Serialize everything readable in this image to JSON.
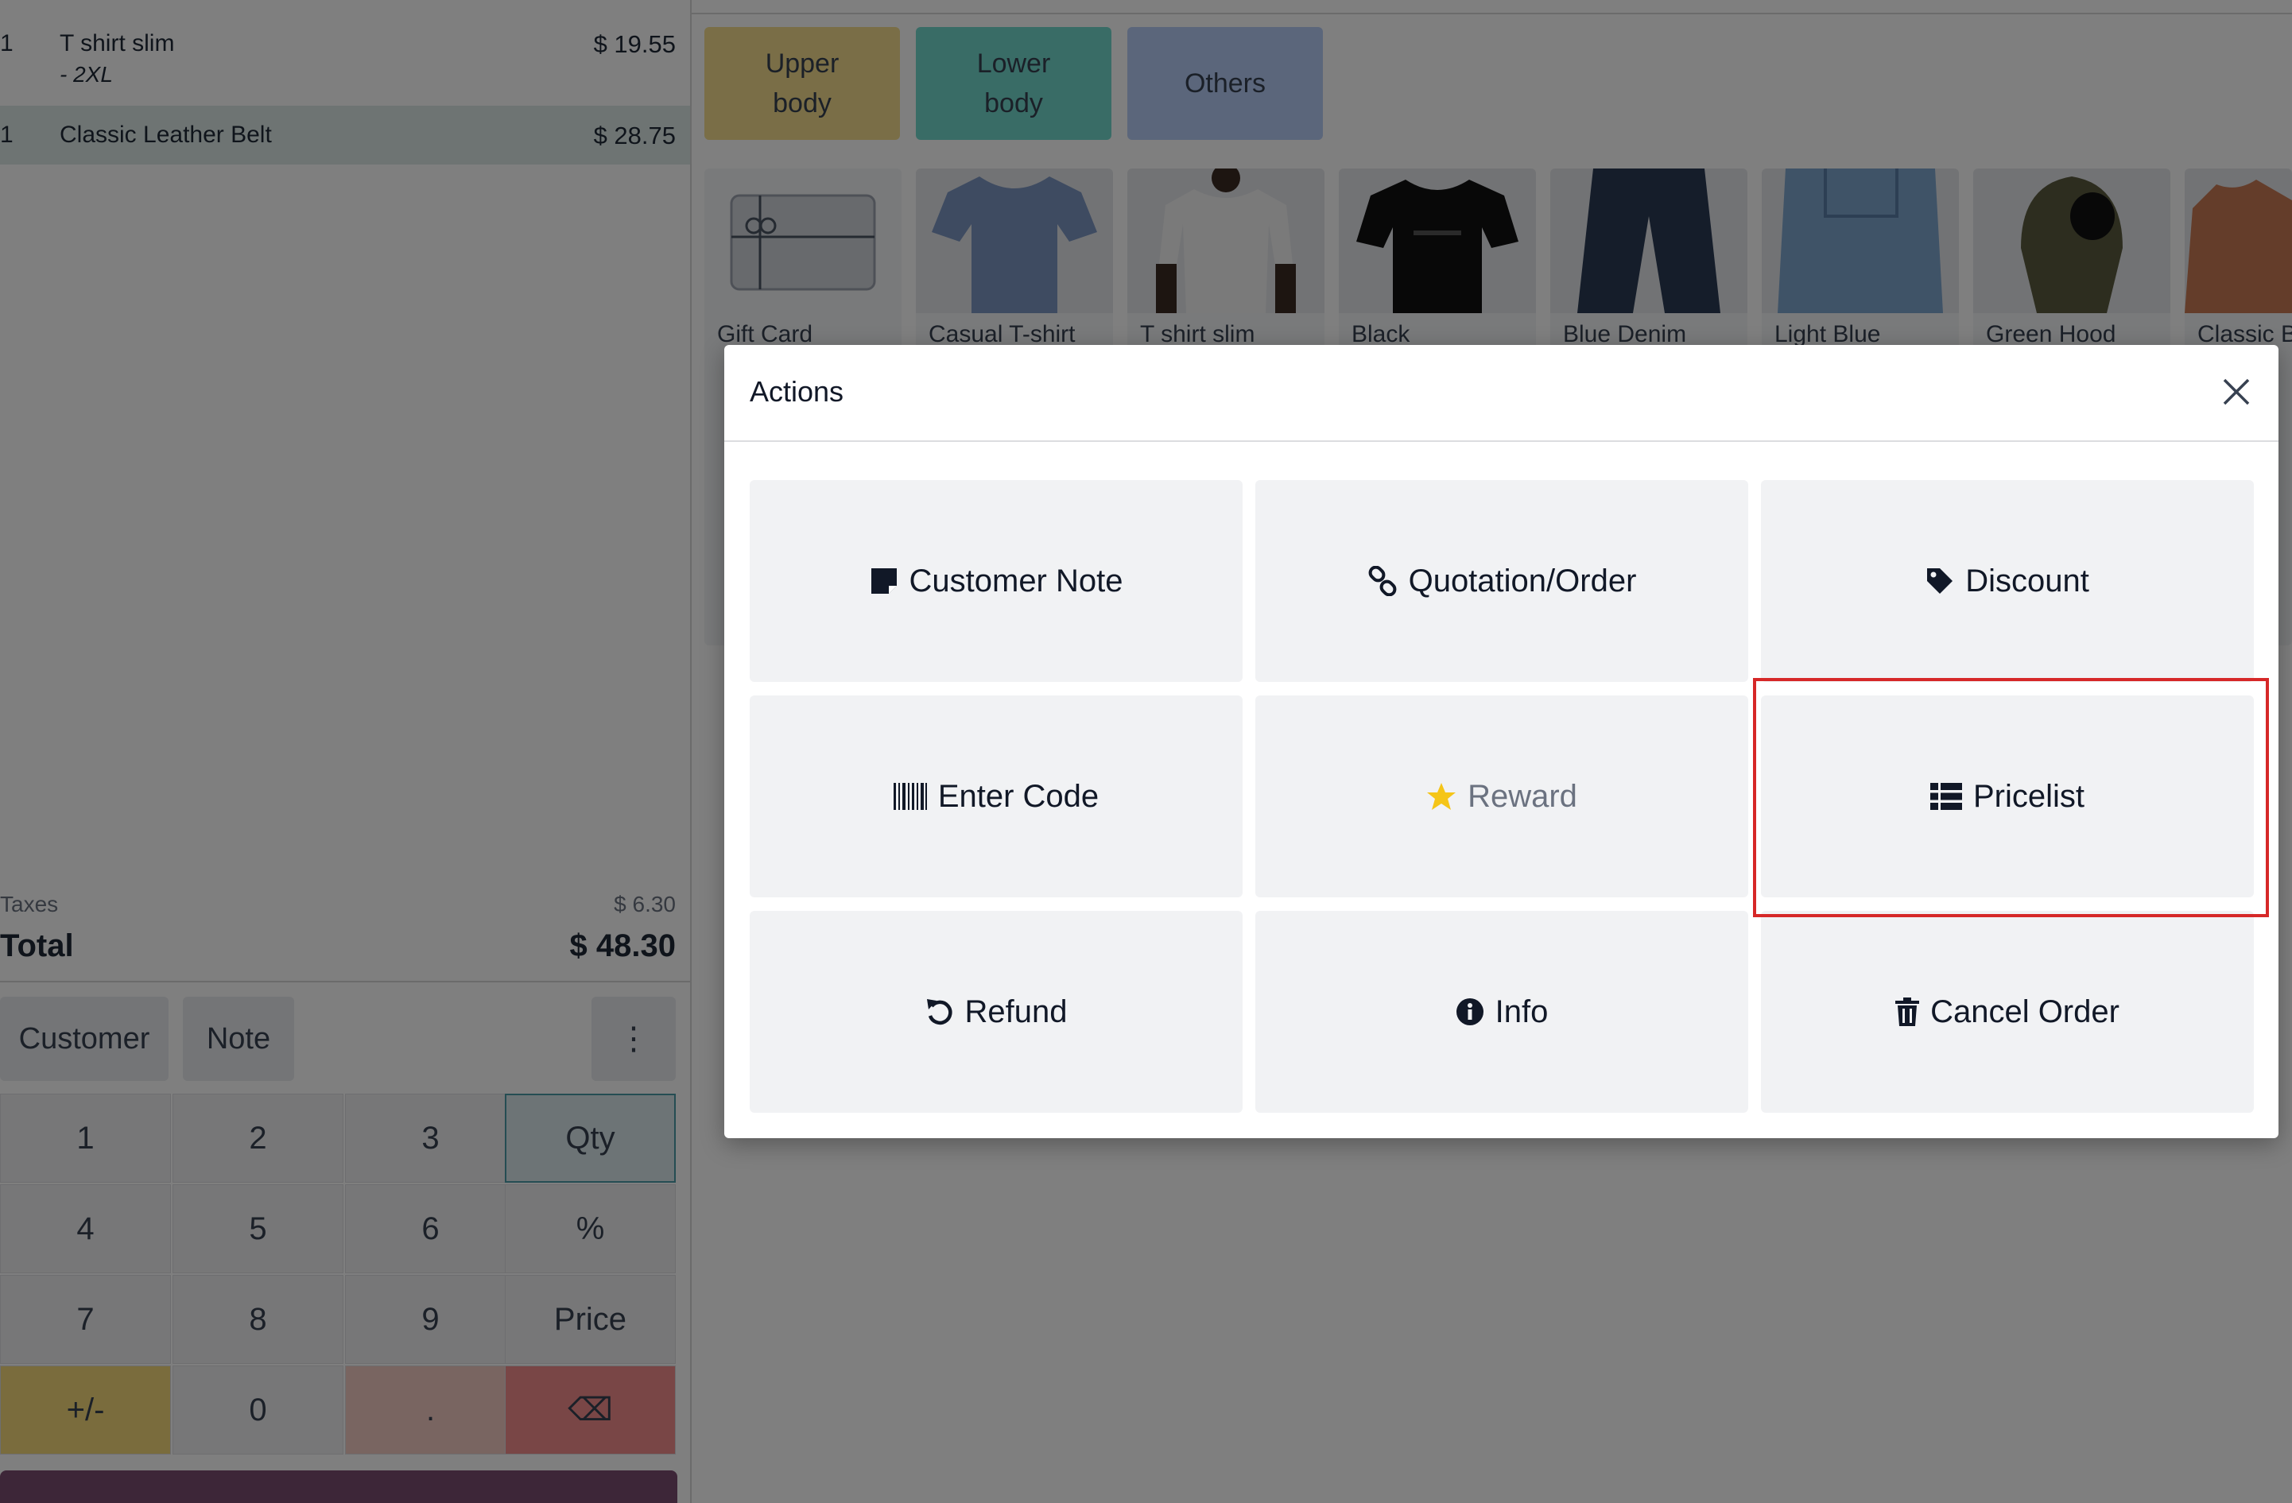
{
  "order": {
    "lines": [
      {
        "qty": "1",
        "name": "T shirt slim",
        "variant": "- 2XL",
        "price": "$ 19.55"
      },
      {
        "qty": "1",
        "name": "Classic Leather Belt",
        "price": "$ 28.75"
      }
    ],
    "taxes_label": "Taxes",
    "taxes_value": "$ 6.30",
    "total_label": "Total",
    "total_value": "$ 48.30"
  },
  "controls": {
    "customer": "Customer",
    "note": "Note",
    "more": "⋮"
  },
  "numpad": {
    "keys": [
      "1",
      "2",
      "3",
      "Qty",
      "4",
      "5",
      "6",
      "%",
      "7",
      "8",
      "9",
      "Price",
      "+/-",
      "0",
      ".",
      "⌫"
    ]
  },
  "categories": [
    {
      "label_line1": "Upper",
      "label_line2": "body",
      "color": "#f5dd8e"
    },
    {
      "label_line1": "Lower",
      "label_line2": "body",
      "color": "#72d8cc"
    },
    {
      "label": "Others",
      "color": "#b6cdf7"
    }
  ],
  "products": [
    {
      "name": "Gift Card"
    },
    {
      "name": "Casual T-shirt"
    },
    {
      "name": "T shirt slim"
    },
    {
      "name": "Black"
    },
    {
      "name": "Blue Denim"
    },
    {
      "name": "Light Blue"
    },
    {
      "name": "Green Hood"
    },
    {
      "name": "Classic B"
    }
  ],
  "modal": {
    "title": "Actions",
    "actions": [
      {
        "label": "Customer Note",
        "icon": "sticky-note-icon"
      },
      {
        "label": "Quotation/Order",
        "icon": "link-icon"
      },
      {
        "label": "Discount",
        "icon": "tag-icon"
      },
      {
        "label": "Enter Code",
        "icon": "barcode-icon"
      },
      {
        "label": "Reward",
        "icon": "star-icon",
        "disabled": true
      },
      {
        "label": "Pricelist",
        "icon": "list-icon",
        "highlighted": true
      },
      {
        "label": "Refund",
        "icon": "undo-icon"
      },
      {
        "label": "Info",
        "icon": "info-circle-icon"
      },
      {
        "label": "Cancel Order",
        "icon": "trash-icon"
      }
    ]
  },
  "colors": {
    "highlight": "#d62828",
    "accent_primary": "#7a4c70",
    "selected_line": "#dde9e6",
    "star": "#f5c518"
  }
}
